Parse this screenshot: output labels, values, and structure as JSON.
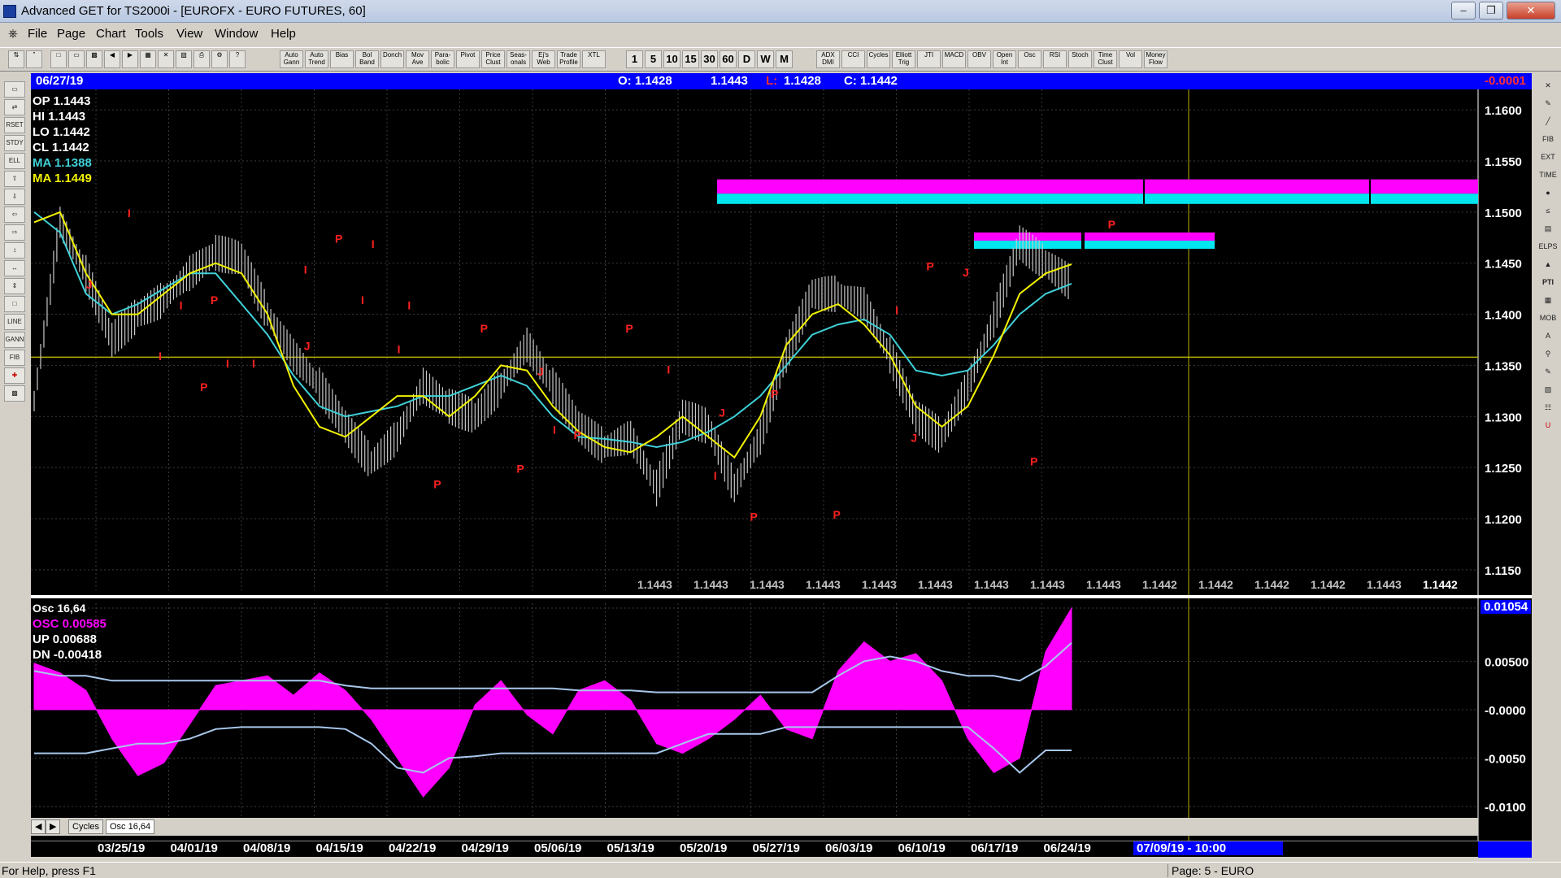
{
  "window": {
    "title": "Advanced GET for TS2000i - [EUROFX - EURO FUTURES, 60]"
  },
  "menu": [
    "File",
    "Page",
    "Chart",
    "Tools",
    "View",
    "Window",
    "Help"
  ],
  "toolbar": {
    "studies": [
      "Auto Gann",
      "Auto Trend",
      "Bias",
      "Bol Band",
      "Donch",
      "Mov Ave",
      "Para-bolic",
      "Pivot",
      "Price Clust",
      "Seas-onals",
      "Ej's Web",
      "Trade Profile",
      "XTL"
    ],
    "intervals": [
      "1",
      "5",
      "10",
      "15",
      "30",
      "60",
      "D",
      "W",
      "M"
    ],
    "indicators": [
      "ADX DMI",
      "CCI",
      "Cycles",
      "Elliott Trig",
      "JTI",
      "MACD",
      "OBV",
      "Open Int",
      "Osc",
      "RSI",
      "Stoch",
      "Time Clust",
      "Vol",
      "Money Flow"
    ]
  },
  "infobar": {
    "date": "06/27/19",
    "open": "O: 1.1428",
    "high": "1.1443",
    "low_label": "L:",
    "low": "1.1428",
    "close": "C: 1.1442",
    "change": "-0.0001"
  },
  "overlay": {
    "op": "OP  1.1443",
    "hi": "HI  1.1443",
    "lo": "LO  1.1442",
    "cl": "CL  1.1442",
    "ma1": "MA  1.1388",
    "ma2": "MA  1.1449",
    "osc_title": "Osc 16,64",
    "osc": "OSC 0.00585",
    "up": "UP   0.00688",
    "dn": "DN   -0.00418",
    "osc_value": "0.01054"
  },
  "bottom_values": [
    "1.1443",
    "1.1443",
    "1.1443",
    "1.1443",
    "1.1443",
    "1.1443",
    "1.1443",
    "1.1443",
    "1.1443",
    "1.1442",
    "1.1442",
    "1.1442",
    "1.1442",
    "1.1443",
    "1.1442"
  ],
  "tabs": [
    "Cycles",
    "Osc 16,64"
  ],
  "date_cursor": "07/09/19 - 10:00",
  "status": {
    "left": "For Help, press F1",
    "right": "Page: 5 - EURO"
  },
  "colors": {
    "price": "#c8c8c8",
    "ma_fast": "#3fd0d8",
    "ma_slow": "#f2f200",
    "osc": "#ff00ff",
    "bands": "#a8c8ec",
    "label": "#ff2020",
    "band_magenta": "#ff00ff",
    "band_cyan": "#00e5ee"
  },
  "chart_data": [
    {
      "type": "line",
      "title": "EUROFX - EURO FUTURES, 60",
      "x": [
        "03/25/19",
        "04/01/19",
        "04/08/19",
        "04/15/19",
        "04/22/19",
        "04/29/19",
        "05/06/19",
        "05/13/19",
        "05/20/19",
        "05/27/19",
        "06/03/19",
        "06/10/19",
        "06/17/19",
        "06/24/19"
      ],
      "ylim": [
        1.113,
        1.162
      ],
      "yticks": [
        "1.1600",
        "1.1550",
        "1.1500",
        "1.1450",
        "1.1400",
        "1.1350",
        "1.1300",
        "1.1250",
        "1.1200",
        "1.1150"
      ],
      "horizontal_line": 1.1358,
      "series": [
        {
          "name": "Price",
          "values": [
            1.1315,
            1.149,
            1.144,
            1.1375,
            1.14,
            1.1415,
            1.144,
            1.146,
            1.1455,
            1.14,
            1.136,
            1.133,
            1.129,
            1.1255,
            1.128,
            1.133,
            1.131,
            1.13,
            1.133,
            1.137,
            1.133,
            1.129,
            1.127,
            1.128,
            1.123,
            1.13,
            1.129,
            1.123,
            1.128,
            1.136,
            1.142,
            1.142,
            1.141,
            1.136,
            1.13,
            1.128,
            1.133,
            1.1395,
            1.147,
            1.145,
            1.143
          ]
        },
        {
          "name": "MA",
          "values": [
            1.15,
            1.148,
            1.142,
            1.14,
            1.141,
            1.1425,
            1.144,
            1.144,
            1.141,
            1.138,
            1.134,
            1.131,
            1.13,
            1.1305,
            1.131,
            1.132,
            1.132,
            1.133,
            1.134,
            1.133,
            1.13,
            1.128,
            1.1278,
            1.1275,
            1.127,
            1.1275,
            1.1285,
            1.13,
            1.132,
            1.135,
            1.138,
            1.139,
            1.1395,
            1.138,
            1.1345,
            1.134,
            1.1345,
            1.137,
            1.14,
            1.142,
            1.143
          ]
        },
        {
          "name": "MA",
          "values": [
            1.149,
            1.15,
            1.144,
            1.14,
            1.14,
            1.142,
            1.144,
            1.145,
            1.144,
            1.14,
            1.133,
            1.129,
            1.128,
            1.13,
            1.132,
            1.132,
            1.13,
            1.132,
            1.135,
            1.1345,
            1.131,
            1.1285,
            1.127,
            1.1265,
            1.128,
            1.13,
            1.128,
            1.126,
            1.13,
            1.137,
            1.14,
            1.141,
            1.139,
            1.136,
            1.131,
            1.129,
            1.131,
            1.136,
            1.142,
            1.144,
            1.1449
          ]
        }
      ],
      "labels": [
        {
          "t": "J",
          "x": 0.05,
          "y": 1.1425
        },
        {
          "t": "I",
          "x": 0.09,
          "y": 1.1495
        },
        {
          "t": "I",
          "x": 0.14,
          "y": 1.1405
        },
        {
          "t": "P",
          "x": 0.17,
          "y": 1.141
        },
        {
          "t": "I",
          "x": 0.12,
          "y": 1.1355
        },
        {
          "t": "P",
          "x": 0.16,
          "y": 1.1325
        },
        {
          "t": "I",
          "x": 0.185,
          "y": 1.1348
        },
        {
          "t": "I",
          "x": 0.21,
          "y": 1.1348
        },
        {
          "t": "I",
          "x": 0.26,
          "y": 1.144
        },
        {
          "t": "J",
          "x": 0.26,
          "y": 1.1365
        },
        {
          "t": "P",
          "x": 0.29,
          "y": 1.147
        },
        {
          "t": "I",
          "x": 0.325,
          "y": 1.1465
        },
        {
          "t": "I",
          "x": 0.315,
          "y": 1.141
        },
        {
          "t": "I",
          "x": 0.36,
          "y": 1.1405
        },
        {
          "t": "I",
          "x": 0.35,
          "y": 1.1362
        },
        {
          "t": "P",
          "x": 0.43,
          "y": 1.1382
        },
        {
          "t": "P",
          "x": 0.385,
          "y": 1.123
        },
        {
          "t": "P",
          "x": 0.465,
          "y": 1.1245
        },
        {
          "t": "J",
          "x": 0.485,
          "y": 1.134
        },
        {
          "t": "I",
          "x": 0.5,
          "y": 1.1283
        },
        {
          "t": "P",
          "x": 0.52,
          "y": 1.1278
        },
        {
          "t": "P",
          "x": 0.57,
          "y": 1.1382
        },
        {
          "t": "I",
          "x": 0.61,
          "y": 1.1342
        },
        {
          "t": "J",
          "x": 0.66,
          "y": 1.13
        },
        {
          "t": "I",
          "x": 0.655,
          "y": 1.1238
        },
        {
          "t": "P",
          "x": 0.69,
          "y": 1.1198
        },
        {
          "t": "P",
          "x": 0.71,
          "y": 1.1318
        },
        {
          "t": "P",
          "x": 0.77,
          "y": 1.12
        },
        {
          "t": "I",
          "x": 0.83,
          "y": 1.14
        },
        {
          "t": "J",
          "x": 0.845,
          "y": 1.1275
        },
        {
          "t": "P",
          "x": 0.86,
          "y": 1.1443
        },
        {
          "t": "J",
          "x": 0.895,
          "y": 1.1437
        },
        {
          "t": "P",
          "x": 0.96,
          "y": 1.1252
        },
        {
          "t": "P",
          "x": 1.035,
          "y": 1.1484
        }
      ]
    },
    {
      "type": "area",
      "title": "Osc 16,64",
      "ylim": [
        -0.011,
        0.011
      ],
      "yticks": [
        "0.01050",
        "0.00500",
        "-0.0000",
        "-0.0050",
        "-0.0100"
      ],
      "series": [
        {
          "name": "OSC",
          "values": [
            0.0048,
            0.0038,
            0.002,
            -0.003,
            -0.0068,
            -0.0055,
            -0.0015,
            0.0025,
            0.003,
            0.0035,
            0.0015,
            0.0038,
            0.002,
            -0.001,
            -0.005,
            -0.009,
            -0.006,
            0.0005,
            0.003,
            -0.0005,
            -0.0025,
            0.002,
            0.003,
            0.001,
            -0.0035,
            -0.0045,
            -0.003,
            -0.001,
            0.0015,
            -0.002,
            -0.003,
            0.004,
            0.007,
            0.005,
            0.0058,
            0.003,
            -0.003,
            -0.0065,
            -0.005,
            0.006,
            0.0105
          ]
        },
        {
          "name": "UP",
          "values": [
            0.004,
            0.0035,
            0.0035,
            0.003,
            0.003,
            0.003,
            0.003,
            0.003,
            0.003,
            0.003,
            0.003,
            0.003,
            0.0025,
            0.0022,
            0.0022,
            0.0022,
            0.0022,
            0.0022,
            0.0022,
            0.0022,
            0.0022,
            0.002,
            0.002,
            0.002,
            0.0018,
            0.0018,
            0.0018,
            0.0018,
            0.0018,
            0.0018,
            0.0018,
            0.0035,
            0.005,
            0.0055,
            0.005,
            0.004,
            0.0035,
            0.0035,
            0.003,
            0.0045,
            0.0069
          ]
        },
        {
          "name": "DN",
          "values": [
            -0.0045,
            -0.0045,
            -0.0045,
            -0.004,
            -0.0035,
            -0.0035,
            -0.003,
            -0.002,
            -0.0018,
            -0.0018,
            -0.0018,
            -0.0018,
            -0.002,
            -0.0035,
            -0.006,
            -0.0065,
            -0.005,
            -0.0048,
            -0.0045,
            -0.0045,
            -0.0045,
            -0.0045,
            -0.0045,
            -0.0045,
            -0.0045,
            -0.0035,
            -0.0025,
            -0.0025,
            -0.0025,
            -0.0018,
            -0.0018,
            -0.0018,
            -0.0018,
            -0.0018,
            -0.0018,
            -0.0018,
            -0.0018,
            -0.004,
            -0.0065,
            -0.0042,
            -0.0042
          ]
        }
      ]
    }
  ]
}
